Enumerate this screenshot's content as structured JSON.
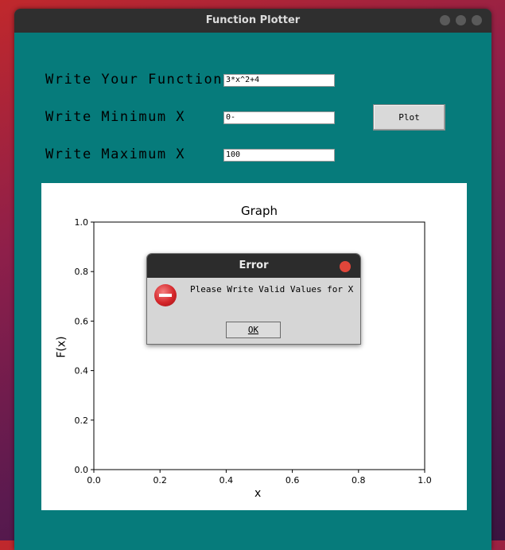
{
  "window": {
    "title": "Function Plotter"
  },
  "form": {
    "function_label": "Write Your Function",
    "function_value": "3*x^2+4",
    "min_label": "Write Minimum X",
    "min_value": "0-",
    "max_label": "Write Maximum X",
    "max_value": "100",
    "plot_button": "Plot"
  },
  "chart_data": {
    "type": "line",
    "title": "Graph",
    "xlabel": "x",
    "ylabel": "F(x)",
    "xlim": [
      0.0,
      1.0
    ],
    "ylim": [
      0.0,
      1.0
    ],
    "xticks": [
      "0.0",
      "0.2",
      "0.4",
      "0.6",
      "0.8",
      "1.0"
    ],
    "yticks": [
      "0.0",
      "0.2",
      "0.4",
      "0.6",
      "0.8",
      "1.0"
    ],
    "series": []
  },
  "dialog": {
    "title": "Error",
    "message": "Please Write Valid Values for X",
    "ok_button": "OK"
  }
}
